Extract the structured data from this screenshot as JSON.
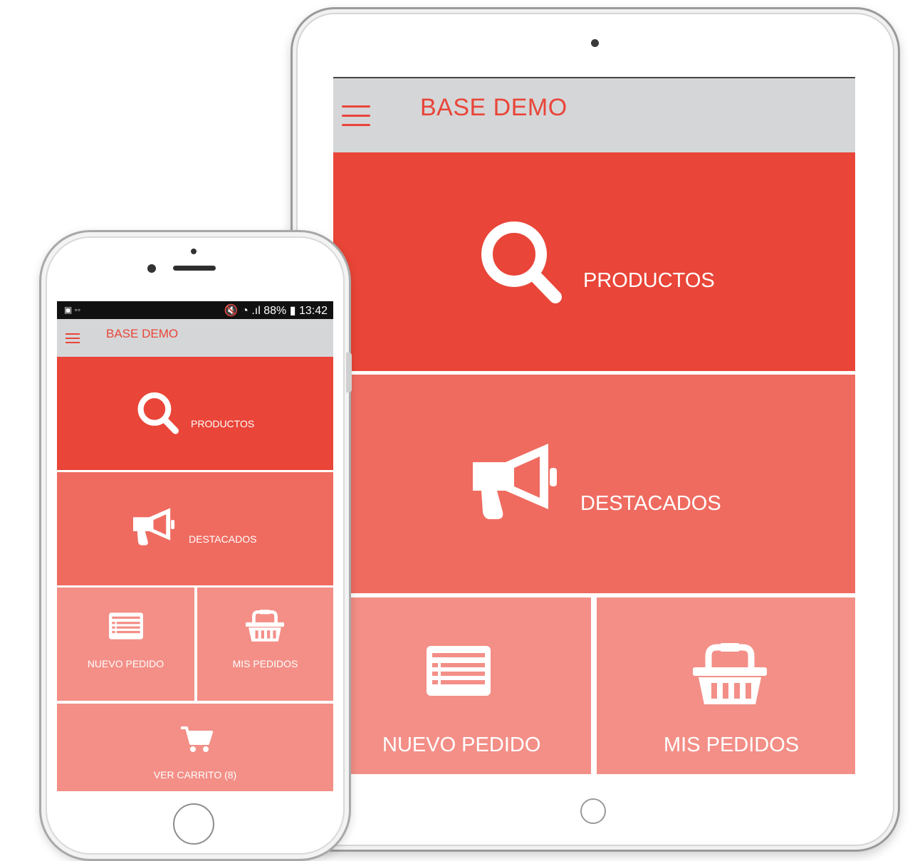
{
  "tablet": {
    "title": "BASE DEMO",
    "tiles": {
      "productos": "PRODUCTOS",
      "destacados": "DESTACADOS",
      "nuevo_pedido": "NUEVO PEDIDO",
      "mis_pedidos": "MIS PEDIDOS"
    }
  },
  "phone": {
    "status_bar": {
      "left": "▣ ◦◦",
      "right": "🔇 ◔ .ıl 88% ▮ 13:42",
      "battery": "88%",
      "time": "13:42"
    },
    "title": "BASE DEMO",
    "tiles": {
      "productos": "PRODUCTOS",
      "destacados": "DESTACADOS",
      "nuevo_pedido": "NUEVO PEDIDO",
      "mis_pedidos": "MIS PEDIDOS",
      "ver_carrito": "VER CARRITO (8)"
    }
  },
  "colors": {
    "accent": "#e94538",
    "tile_mid": "#ef6b60",
    "tile_light": "#f38f87",
    "header_bg": "#d5d6d8"
  },
  "icons": [
    "menu-icon",
    "search-icon",
    "megaphone-icon",
    "order-form-icon",
    "basket-icon",
    "cart-icon"
  ]
}
